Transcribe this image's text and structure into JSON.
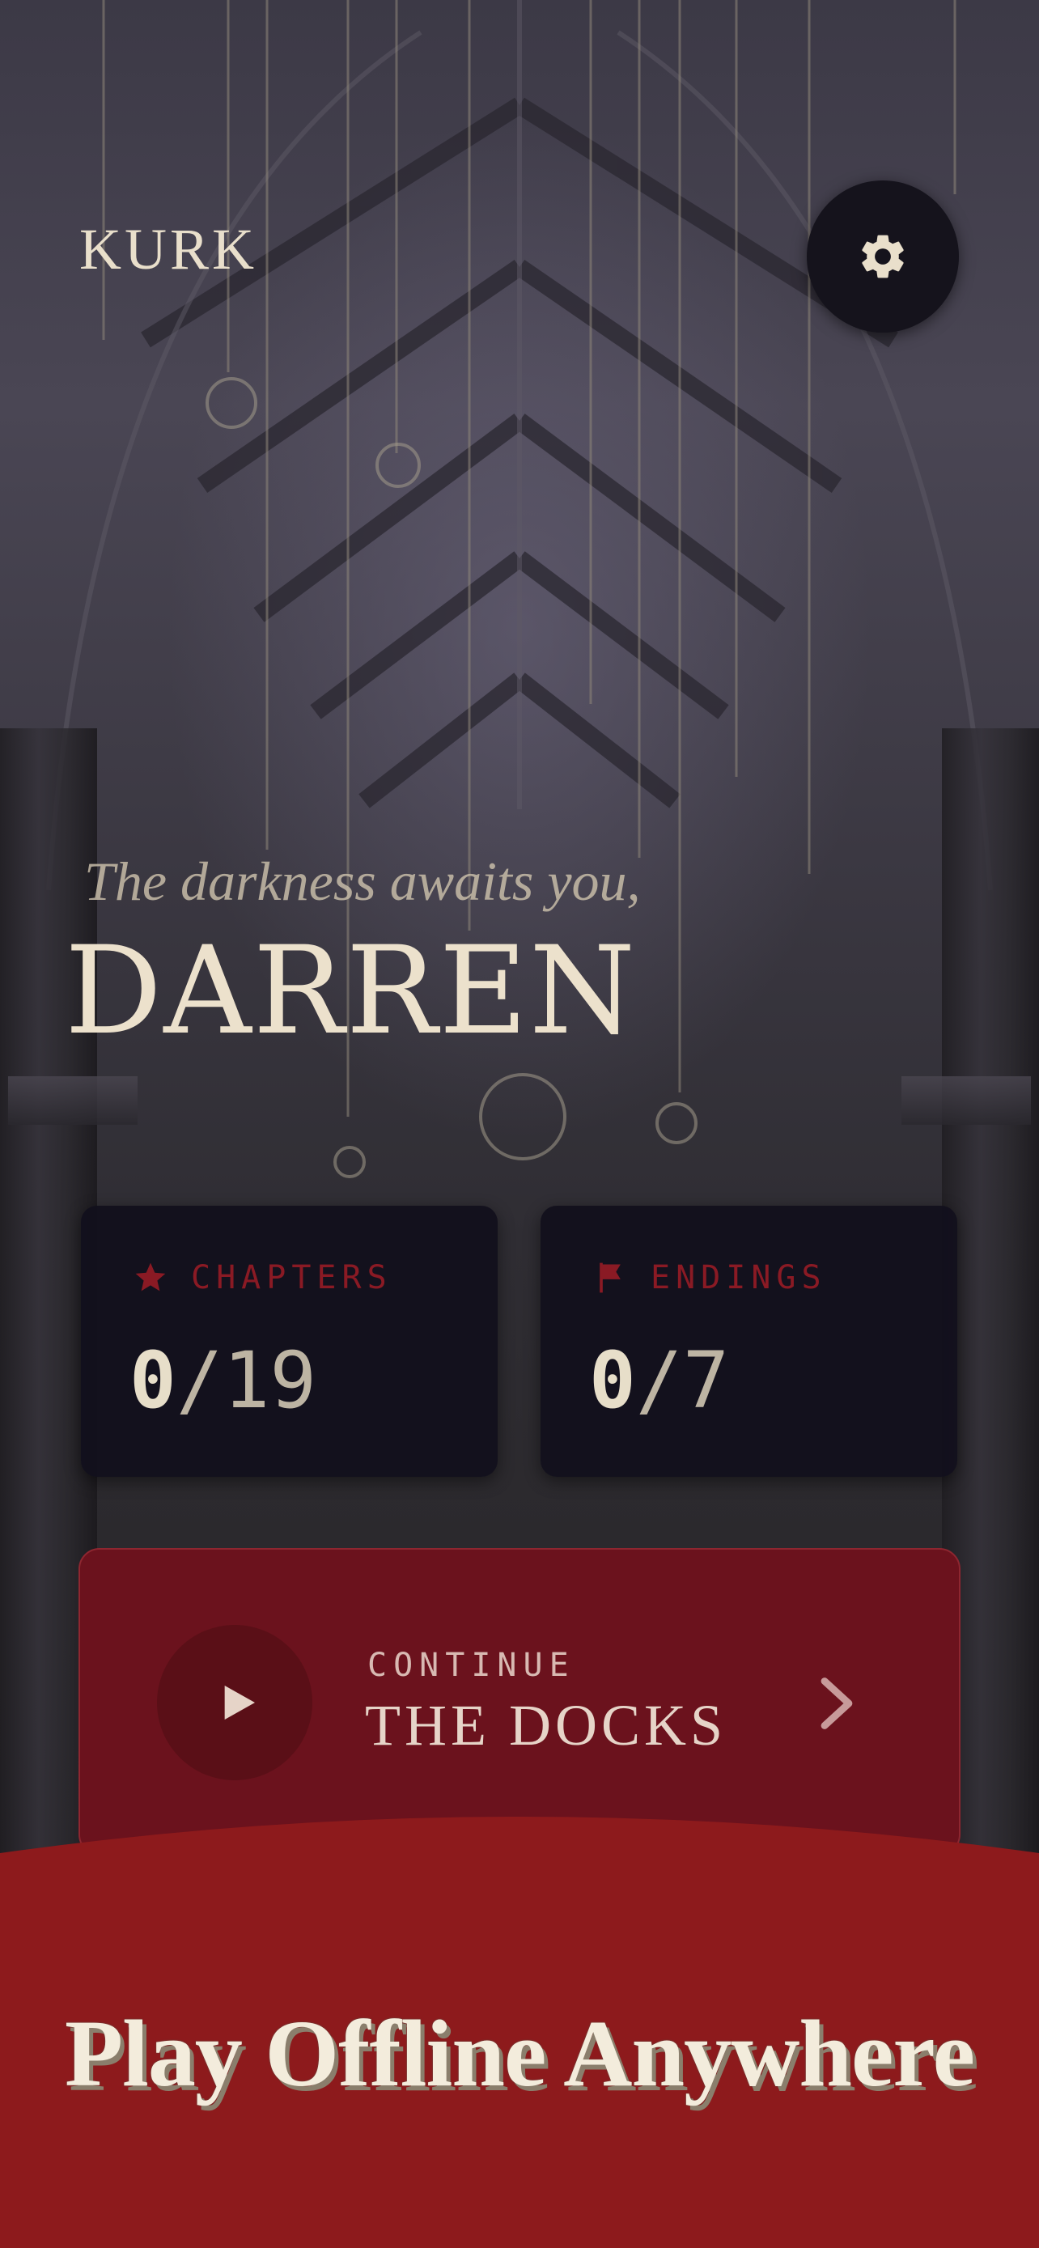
{
  "app": {
    "title": "KURK"
  },
  "header": {
    "settings_icon": "gear-icon"
  },
  "greeting": {
    "subtitle": "The darkness awaits you,",
    "name": "DARREN"
  },
  "stats": {
    "chapters": {
      "label": "CHAPTERS",
      "icon": "star-icon",
      "current": "0",
      "separator": "/",
      "total": "19"
    },
    "endings": {
      "label": "ENDINGS",
      "icon": "flag-icon",
      "current": "0",
      "separator": "/",
      "total": "7"
    }
  },
  "continue": {
    "label": "CONTINUE",
    "title": "THE DOCKS",
    "icon": "play-icon"
  },
  "promo": {
    "text": "Play Offline Anywhere"
  },
  "colors": {
    "accent_red": "#8a1a24",
    "card_dark": "#12101c",
    "continue_bg": "#6b121d",
    "promo_bg": "#8d1a1c",
    "cream": "#ece1cc"
  }
}
